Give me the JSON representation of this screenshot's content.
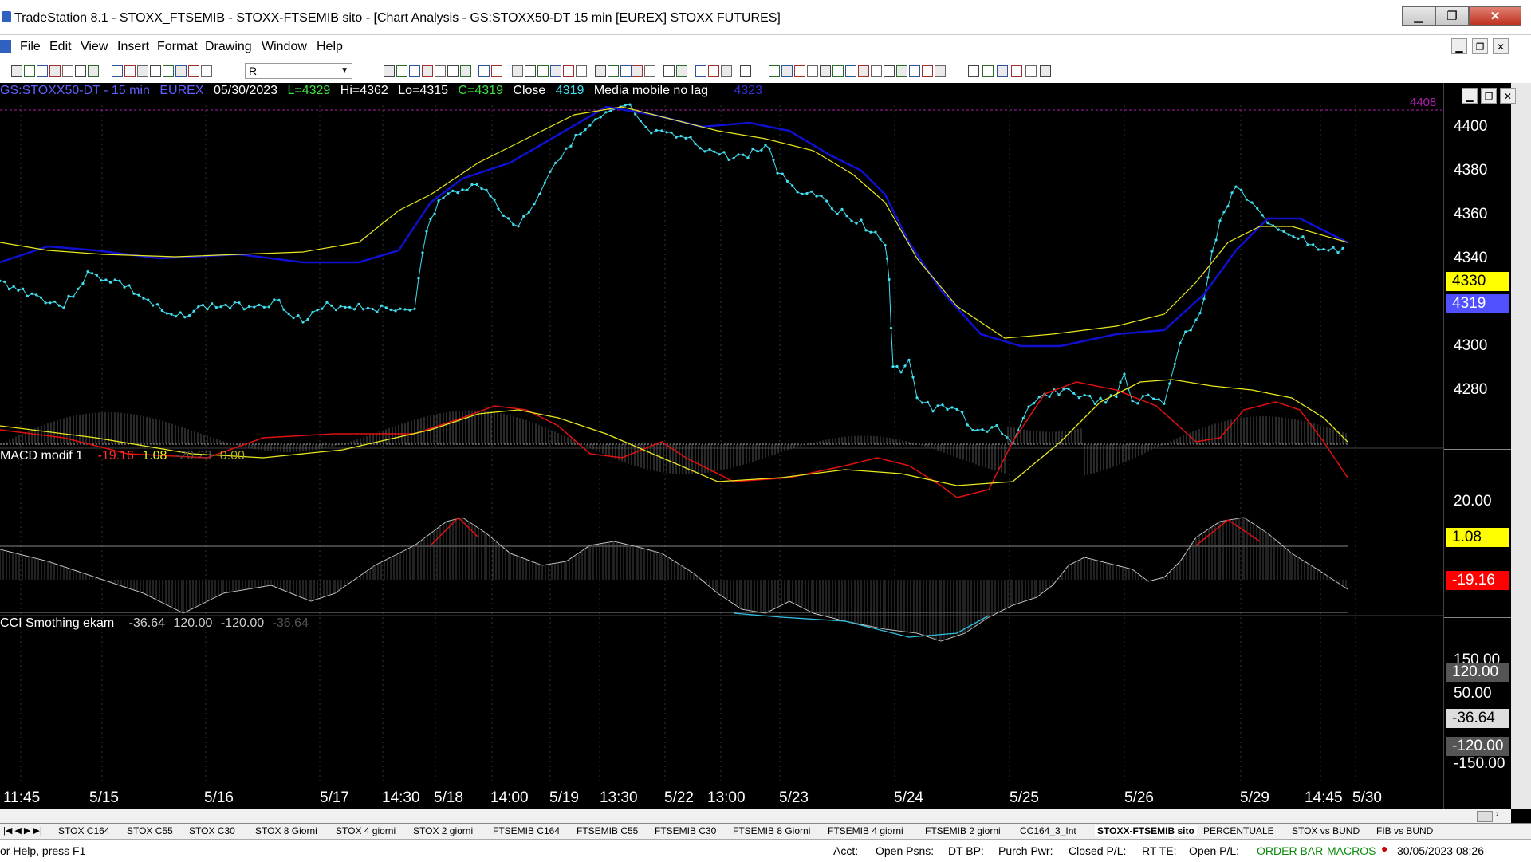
{
  "window": {
    "title": "TradeStation 8.1 - STOXX_FTSEMIB - STOXX-FTSEMIB sito - [Chart Analysis - GS:STOXX50-DT  15 min  [EUREX] STOXX FUTURES]",
    "minimize": "▁",
    "restore": "❐",
    "close": "✕"
  },
  "menu": [
    "File",
    "Edit",
    "View",
    "Insert",
    "Format",
    "Drawing",
    "Window",
    "Help"
  ],
  "toolbar": {
    "symbol_value": "R"
  },
  "status": {
    "symbol": "GS:STOXX50-DT - 15 min",
    "exchange": "EUREX",
    "date": "05/30/2023",
    "low_last": "L=4329",
    "high": "Hi=4362",
    "low": "Lo=4315",
    "close": "C=4319",
    "close_label": "Close",
    "close_value": "4319",
    "ma_label": "Media mobile no lag",
    "ma_value": "4323",
    "top_right": "4408"
  },
  "macd": {
    "label": "MACD modif 1",
    "v1": "-19.16",
    "v2": "1.08",
    "v3": "-20.23",
    "v4": "0.00"
  },
  "cci": {
    "label": "CCI Smothing ekam",
    "v1": "-36.64",
    "v2": "120.00",
    "v3": "-120.00",
    "v4": "-36.64"
  },
  "price_axis": {
    "ticks": [
      "4400",
      "4380",
      "4360",
      "4340",
      "4300",
      "4280"
    ],
    "badge_yellow": "4330",
    "badge_blue": "4319"
  },
  "macd_axis": {
    "tick": "20.00",
    "badge_yellow": "1.08",
    "badge_red": "-19.16"
  },
  "cci_axis": {
    "tick_top": "150.00",
    "badge_120": "120.00",
    "tick_50": "50.00",
    "badge_value": "-36.64",
    "badge_m120": "-120.00",
    "tick_bottom": "-150.00"
  },
  "time_axis": [
    "11:45",
    "5/15",
    "5/16",
    "5/17",
    "14:30",
    "5/18",
    "14:00",
    "5/19",
    "13:30",
    "5/22",
    "13:00",
    "5/23",
    "5/24",
    "5/25",
    "5/26",
    "5/29",
    "14:45",
    "5/30"
  ],
  "tabs": [
    "STOX C164",
    "STOX C55",
    "STOX C30",
    "STOX 8 Giorni",
    "STOX 4 giorni",
    "STOX 2 giorni",
    "FTSEMIB C164",
    "FTSEMIB C55",
    "FTSEMIB C30",
    "FTSEMIB 8 Giorni",
    "FTSEMIB 4 giorni",
    "FTSEMIB 2 giorni",
    "CC164_3_Int",
    "STOXX-FTSEMIB sito",
    "PERCENTUALE",
    "STOX vs BUND",
    "FIB vs BUND"
  ],
  "statusbar": {
    "help": "or Help, press F1",
    "acct": "Acct:",
    "open_psns": "Open Psns:",
    "dt_bp": "DT BP:",
    "purch_pwr": "Purch Pwr:",
    "closed_pl": "Closed P/L:",
    "rt_te": "RT TE:",
    "open_pl": "Open P/L:",
    "order_bar": "ORDER BAR",
    "macros": "MACROS",
    "datetime": "30/05/2023 08:26"
  },
  "colors": {
    "price_dots": "#40e0f0",
    "ma_blue": "#1010d0",
    "ma_yellow": "#e8e820",
    "macd_red": "#e01010",
    "green": "#40e040",
    "purple": "#b020b0"
  }
}
